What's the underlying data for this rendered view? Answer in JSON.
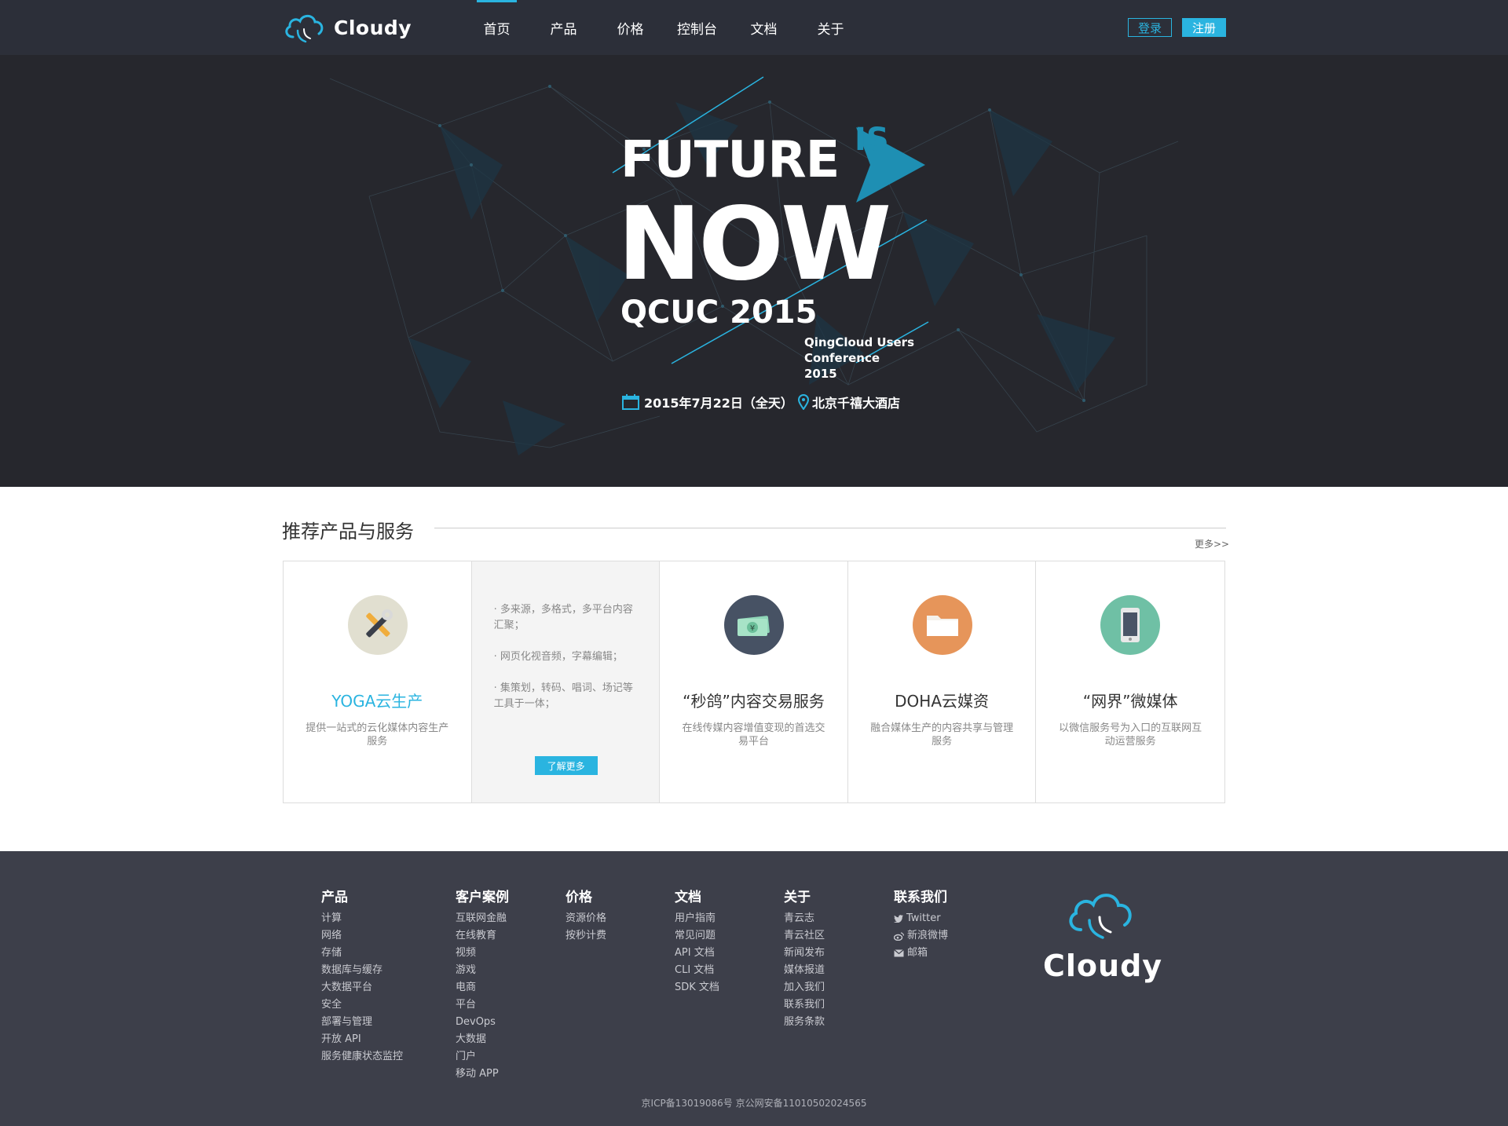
{
  "header": {
    "logo_text": "Cloudy",
    "nav": [
      {
        "label": "首页",
        "active": true
      },
      {
        "label": "产品"
      },
      {
        "label": "价格"
      },
      {
        "label": "控制台"
      },
      {
        "label": "文档"
      },
      {
        "label": "关于"
      }
    ],
    "login_label": "登录",
    "register_label": "注册"
  },
  "hero": {
    "line1": "FUTURE",
    "is_mark": "IS",
    "line2": "NOW",
    "line3": "QCUC 2015",
    "conference": [
      "QingCloud Users",
      "Conference",
      "2015"
    ],
    "date": "2015年7月22日（全天）",
    "location": "北京千禧大酒店"
  },
  "section": {
    "title": "推荐产品与服务",
    "more": "更多>>"
  },
  "cards": [
    {
      "title": "YOGA云生产",
      "desc": "提供一站式的云化媒体内容生产服务",
      "icon": "tools-icon",
      "color": "#e1dfd0"
    },
    {
      "list": [
        "· 多来源，多格式，多平台内容汇聚；",
        "· 网页化视音频，字幕编辑；",
        "· 集策划，转码、唱词、场记等工具于一体；"
      ],
      "button": "了解更多"
    },
    {
      "title": "“秒鸽”内容交易服务",
      "desc": "在线传媒内容增值变现的首选交易平台",
      "icon": "money-icon",
      "color": "#475264"
    },
    {
      "title": "DOHA云媒资",
      "desc": "融合媒体生产的内容共享与管理服务",
      "icon": "folder-icon",
      "color": "#e6955a"
    },
    {
      "title": "“网界”微媒体",
      "desc": "以微信服务号为入口的互联网互动运营服务",
      "icon": "phone-icon",
      "color": "#6fc0a5"
    }
  ],
  "footer": {
    "columns": [
      {
        "title": "产品",
        "items": [
          "计算",
          "网络",
          "存储",
          "数据库与缓存",
          "大数据平台",
          "安全",
          "部署与管理",
          "开放 API",
          "服务健康状态监控"
        ]
      },
      {
        "title": "客户案例",
        "items": [
          "互联网金融",
          "在线教育",
          "视频",
          "游戏",
          "电商",
          "平台",
          "DevOps",
          "大数据",
          "门户",
          "移动 APP"
        ]
      },
      {
        "title": "价格",
        "items": [
          "资源价格",
          "按秒计费"
        ]
      },
      {
        "title": "文档",
        "items": [
          "用户指南",
          "常见问题",
          "API 文档",
          "CLI 文档",
          "SDK 文档"
        ]
      },
      {
        "title": "关于",
        "items": [
          "青云志",
          "青云社区",
          "新闻发布",
          "媒体报道",
          "加入我们",
          "联系我们",
          "服务条款"
        ]
      },
      {
        "title": "联系我们",
        "items": [
          "Twitter",
          "新浪微博",
          "邮箱"
        ]
      }
    ],
    "logo_text": "Cloudy",
    "copyright": "京ICP备13019086号 京公网安备11010502024565"
  }
}
